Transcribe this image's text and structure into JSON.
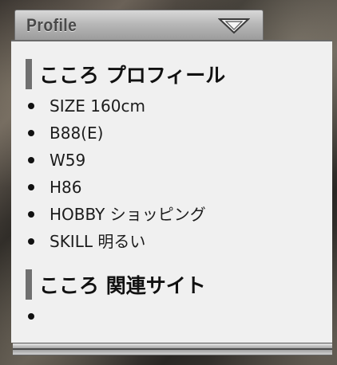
{
  "widget": {
    "title": "Profile",
    "toggle_icon": "triangle-down-icon"
  },
  "sections": [
    {
      "heading": "こころ プロフィール",
      "items": [
        "SIZE 160cm",
        "B88(E)",
        "W59",
        "H86",
        "HOBBY ショッピング",
        "SKILL 明るい"
      ]
    },
    {
      "heading": "こころ 関連サイト",
      "items": [
        ""
      ]
    }
  ],
  "colors": {
    "panel_bg": "#f0f0f0",
    "heading_bar": "#707070",
    "tab_bg": "#b8b8b8"
  }
}
